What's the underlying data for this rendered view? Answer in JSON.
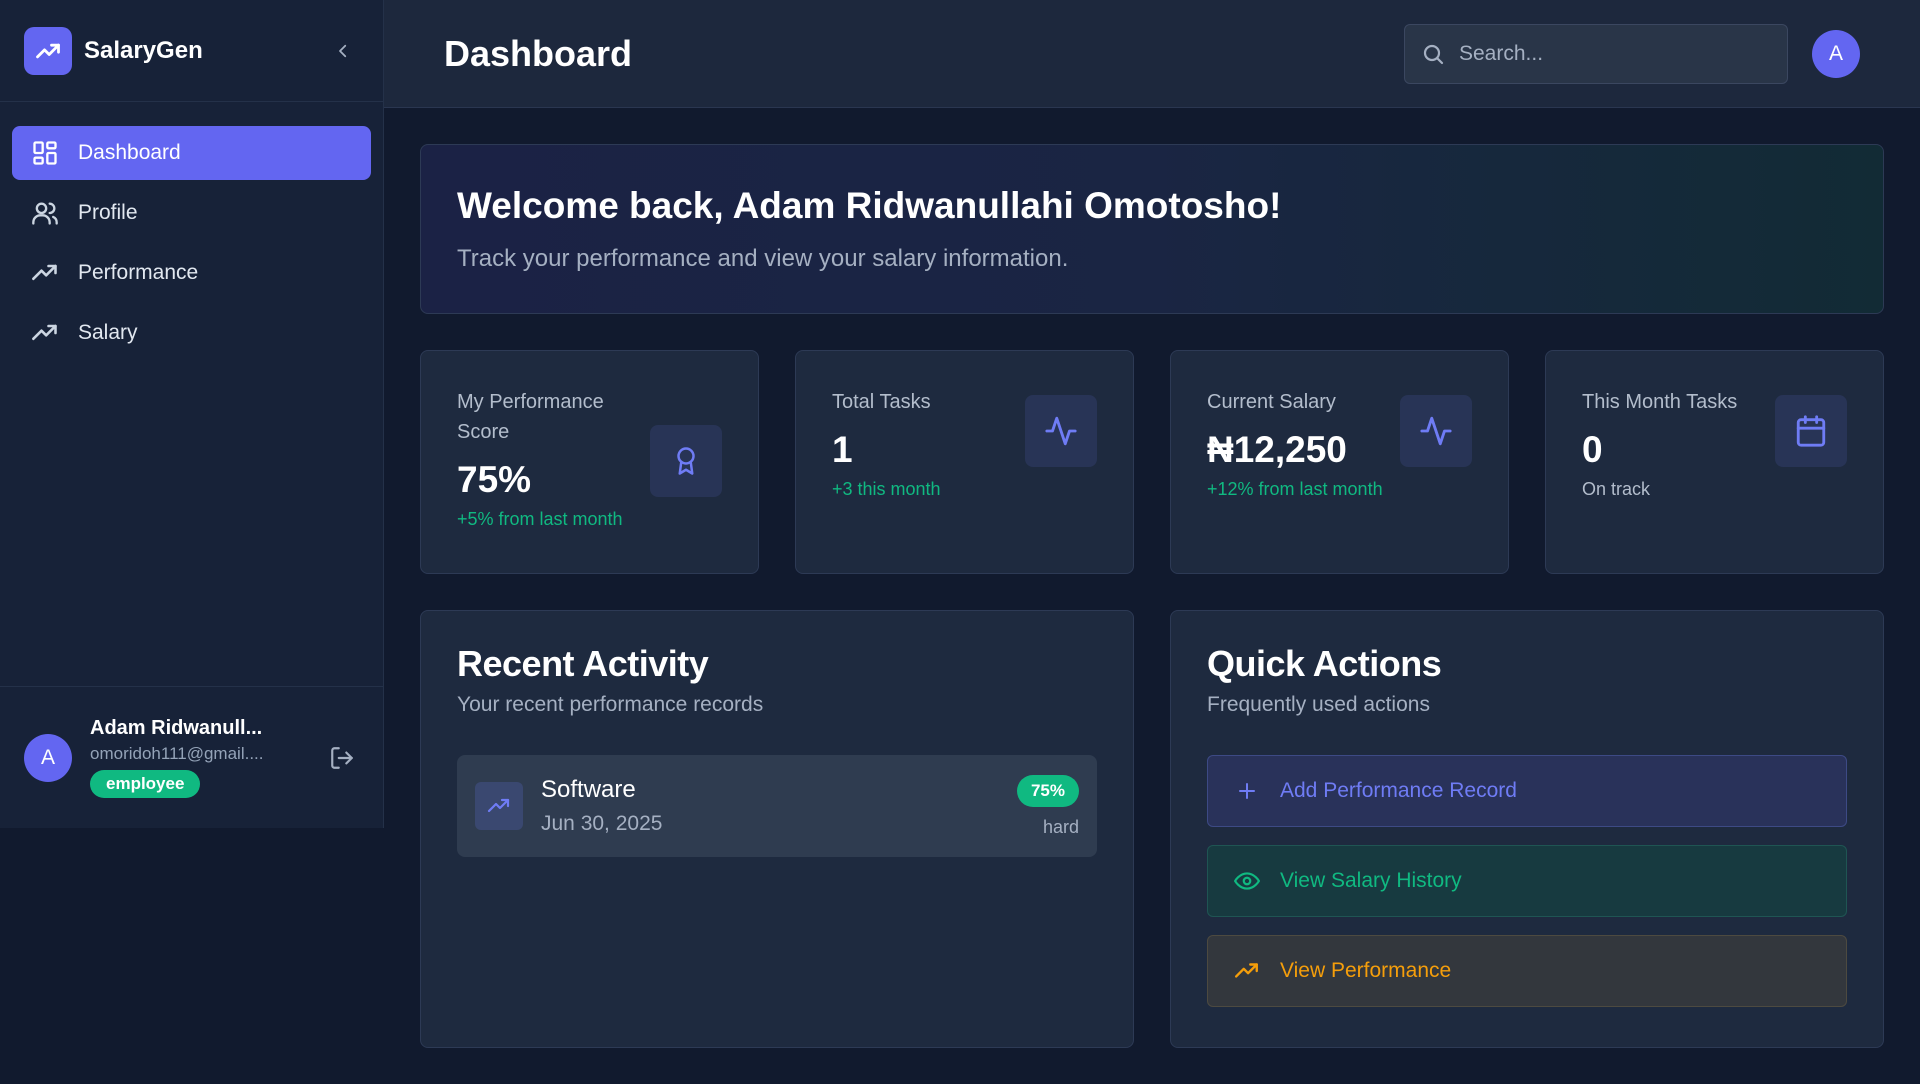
{
  "sidebar": {
    "brand": "SalaryGen",
    "items": [
      {
        "label": "Dashboard",
        "icon": "dashboard-grid-icon"
      },
      {
        "label": "Profile",
        "icon": "users-icon"
      },
      {
        "label": "Performance",
        "icon": "trending-up-icon"
      },
      {
        "label": "Salary",
        "icon": "trending-up-icon"
      }
    ],
    "active_item": "Dashboard",
    "user": {
      "initial": "A",
      "name": "Adam Ridwanull...",
      "email": "omoridoh111@gmail....",
      "role": "employee"
    }
  },
  "header": {
    "title": "Dashboard",
    "search_placeholder": "Search...",
    "avatar_initial": "A"
  },
  "welcome": {
    "title": "Welcome back, Adam Ridwanullahi Omotosho!",
    "subtitle": "Track your performance and view your salary information."
  },
  "stats": [
    {
      "label": "My Performance Score",
      "value": "75%",
      "sub": "+5% from last month",
      "icon": "award-icon"
    },
    {
      "label": "Total Tasks",
      "value": "1",
      "sub": "+3 this month",
      "icon": "activity-icon"
    },
    {
      "label": "Current Salary",
      "value": "₦12,250",
      "sub": "+12% from last month",
      "icon": "activity-icon"
    },
    {
      "label": "This Month Tasks",
      "value": "0",
      "sub": "On track",
      "icon": "calendar-icon"
    }
  ],
  "recent_activity": {
    "title": "Recent Activity",
    "subtitle": "Your recent performance records",
    "items": [
      {
        "name": "Software",
        "date": "Jun 30, 2025",
        "score": "75%",
        "difficulty": "hard"
      }
    ]
  },
  "quick_actions": {
    "title": "Quick Actions",
    "subtitle": "Frequently used actions",
    "items": [
      {
        "label": "Add Performance Record",
        "icon": "plus-icon",
        "color": "#6f7cf5"
      },
      {
        "label": "View Salary History",
        "icon": "eye-icon",
        "color": "#10b981"
      },
      {
        "label": "View Performance",
        "icon": "trending-up-icon",
        "color": "#f59e0b"
      }
    ]
  },
  "colors": {
    "accent": "#6366f1",
    "success": "#10b981",
    "warning": "#f59e0b",
    "background": "#111a2e"
  }
}
